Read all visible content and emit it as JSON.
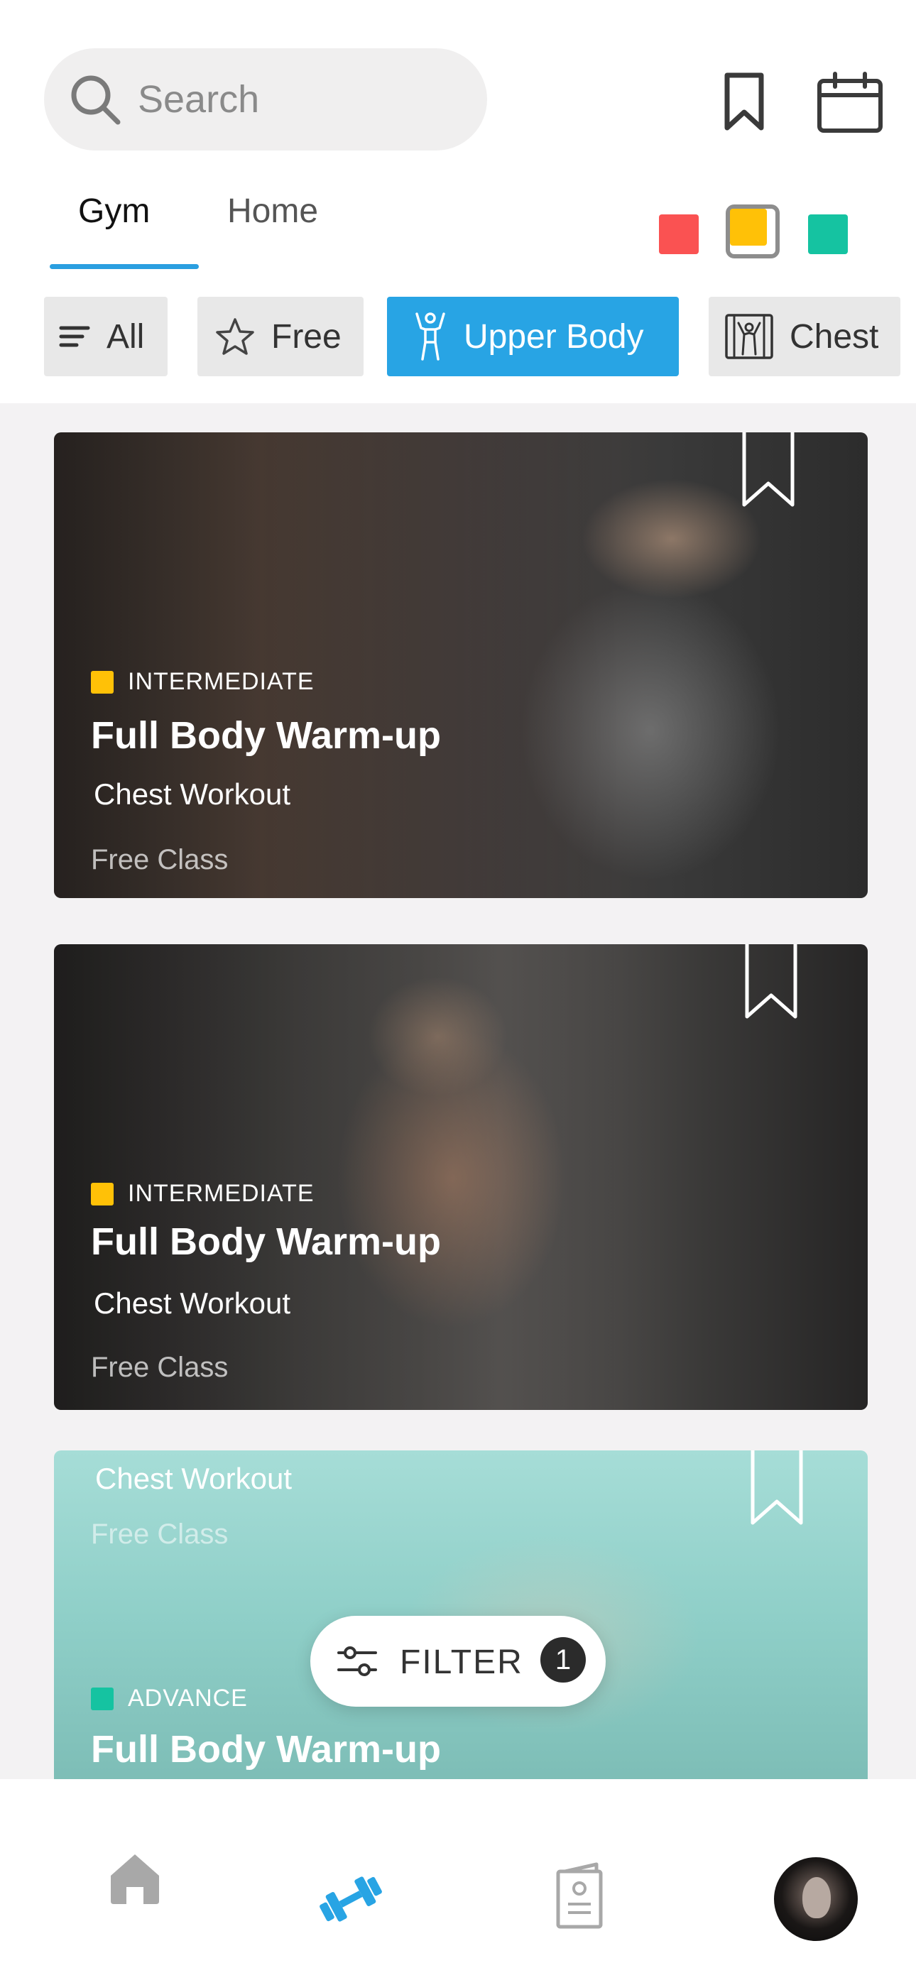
{
  "search": {
    "placeholder": "Search"
  },
  "header": {
    "bookmark_icon": "bookmark-icon",
    "calendar_icon": "calendar-icon"
  },
  "tabs": [
    {
      "label": "Gym",
      "active": true
    },
    {
      "label": "Home",
      "active": false
    }
  ],
  "color_filters": [
    {
      "color": "#fa5252",
      "selected": false
    },
    {
      "color": "#ffc107",
      "selected": true
    },
    {
      "color": "#15c3a1",
      "selected": false
    }
  ],
  "chips": [
    {
      "label": "All",
      "icon": "list-icon",
      "active": false
    },
    {
      "label": "Free",
      "icon": "star-icon",
      "active": false
    },
    {
      "label": "Upper Body",
      "icon": "person-icon",
      "active": true
    },
    {
      "label": "Chest",
      "icon": "chest-icon",
      "active": false
    }
  ],
  "cards": [
    {
      "level": "INTERMEDIATE",
      "level_color": "#ffc107",
      "title": "Full Body Warm-up",
      "subtitle": "Chest Workout",
      "price": "Free Class"
    },
    {
      "level": "INTERMEDIATE",
      "level_color": "#ffc107",
      "title": "Full Body Warm-up",
      "subtitle": "Chest Workout",
      "price": "Free Class"
    },
    {
      "level": "ADVANCE",
      "level_color": "#15c3a1",
      "title": "Full Body Warm-up",
      "subtitle": "Chest Workout",
      "price": "Free Class"
    }
  ],
  "filter": {
    "label": "FILTER",
    "count": "1"
  },
  "nav": [
    {
      "icon": "home-icon",
      "active": false
    },
    {
      "icon": "dumbbell-icon",
      "active": true
    },
    {
      "icon": "notes-icon",
      "active": false
    },
    {
      "icon": "avatar",
      "active": false
    }
  ],
  "colors": {
    "accent": "#28a4e4"
  }
}
